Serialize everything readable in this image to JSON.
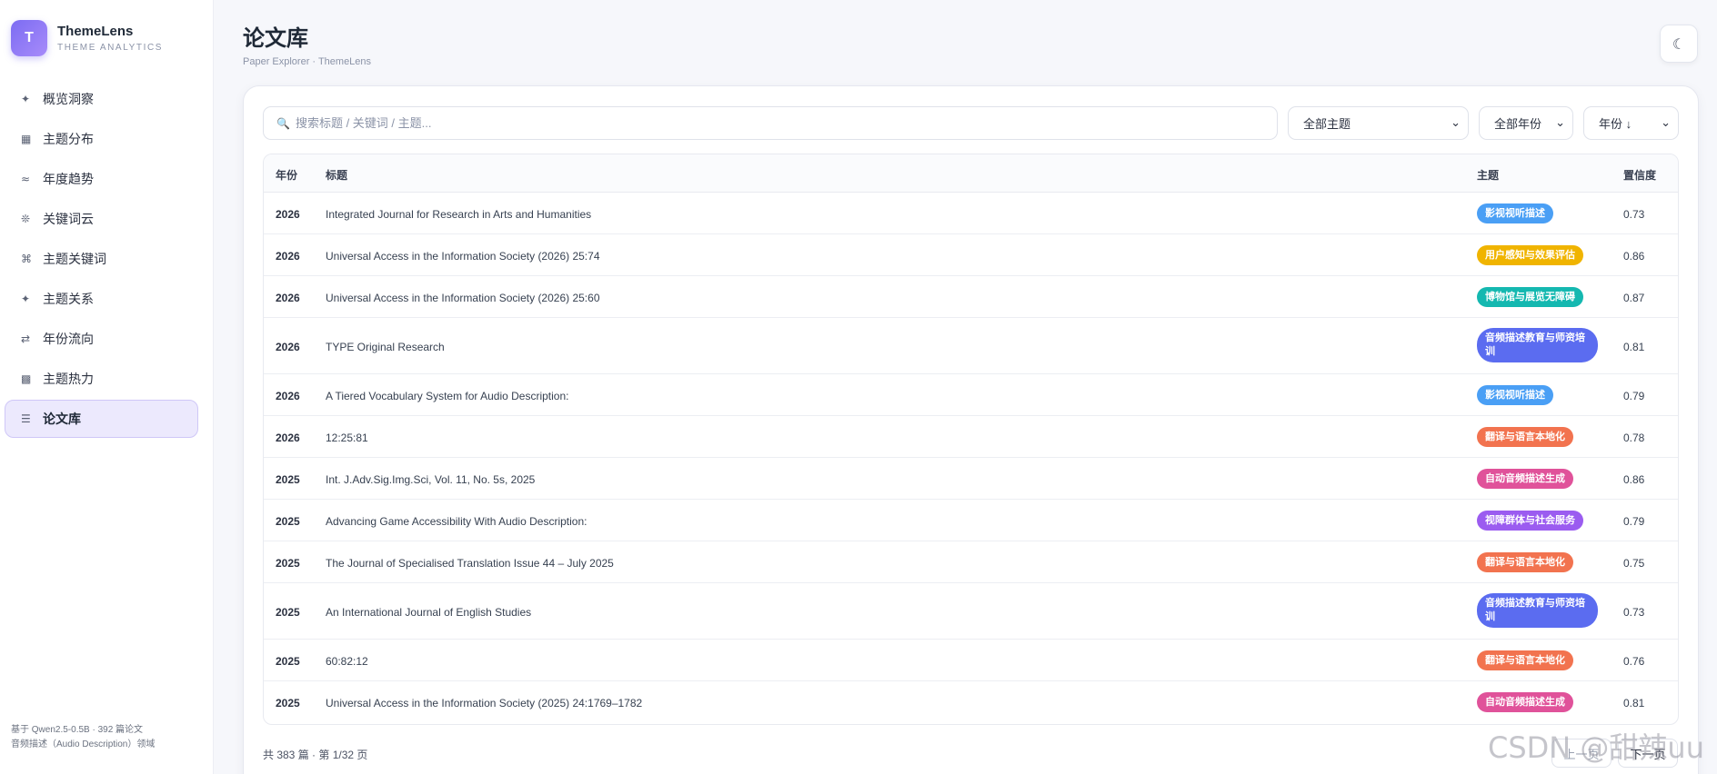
{
  "brand": {
    "logo_letter": "T",
    "name": "ThemeLens",
    "subtitle": "THEME ANALYTICS"
  },
  "sidebar": {
    "items": [
      {
        "icon": "✦",
        "icon_name": "sparkle-icon",
        "label": "概览洞察"
      },
      {
        "icon": "▦",
        "icon_name": "bar-grid-icon",
        "label": "主题分布"
      },
      {
        "icon": "≈",
        "icon_name": "wave-icon",
        "label": "年度趋势"
      },
      {
        "icon": "❊",
        "icon_name": "asterisk-icon",
        "label": "关键词云"
      },
      {
        "icon": "⌘",
        "icon_name": "command-icon",
        "label": "主题关键词"
      },
      {
        "icon": "✦",
        "icon_name": "star-icon",
        "label": "主题关系"
      },
      {
        "icon": "⇄",
        "icon_name": "arrows-icon",
        "label": "年份流向"
      },
      {
        "icon": "▩",
        "icon_name": "heatmap-icon",
        "label": "主题热力"
      },
      {
        "icon": "☰",
        "icon_name": "list-icon",
        "label": "论文库",
        "active": true
      }
    ],
    "footer_line1": "基于 Qwen2.5-0.5B · 392 篇论文",
    "footer_line2": "音频描述（Audio Description）领域"
  },
  "header": {
    "title": "论文库",
    "subtitle": "Paper Explorer · ThemeLens",
    "theme_toggle_icon": "☾"
  },
  "filters": {
    "search_icon": "🔍",
    "search_placeholder": "搜索标题 / 关键词 / 主题...",
    "topic_select": "全部主题",
    "year_select": "全部年份",
    "sort_select": "年份 ↓",
    "chevron": "⌄"
  },
  "table": {
    "headers": {
      "year": "年份",
      "title": "标题",
      "topic": "主题",
      "confidence": "置信度"
    },
    "rows": [
      {
        "year": "2026",
        "title": "Integrated Journal for Research in Arts and Humanities",
        "topic": "影视视听描述",
        "topic_color": "#4a9ff5",
        "confidence": "0.73"
      },
      {
        "year": "2026",
        "title": "Universal Access in the Information Society (2026) 25:74",
        "topic": "用户感知与效果评估",
        "topic_color": "#f0b400",
        "confidence": "0.86"
      },
      {
        "year": "2026",
        "title": "Universal Access in the Information Society (2026) 25:60",
        "topic": "博物馆与展览无障碍",
        "topic_color": "#14b8b0",
        "confidence": "0.87"
      },
      {
        "year": "2026",
        "title": "TYPE Original Research",
        "topic": "音频描述教育与师资培训",
        "topic_color": "#5b6cf0",
        "confidence": "0.81",
        "tall": true
      },
      {
        "year": "2026",
        "title": "A Tiered Vocabulary System for Audio Description:",
        "topic": "影视视听描述",
        "topic_color": "#4a9ff5",
        "confidence": "0.79"
      },
      {
        "year": "2026",
        "title": "12:25:81",
        "topic": "翻译与语言本地化",
        "topic_color": "#f2734f",
        "confidence": "0.78"
      },
      {
        "year": "2025",
        "title": "Int. J.Adv.Sig.Img.Sci, Vol. 11, No. 5s, 2025",
        "topic": "自动音频描述生成",
        "topic_color": "#e0529a",
        "confidence": "0.86"
      },
      {
        "year": "2025",
        "title": "Advancing Game Accessibility With Audio Description:",
        "topic": "视障群体与社会服务",
        "topic_color": "#9b5cf0",
        "confidence": "0.79"
      },
      {
        "year": "2025",
        "title": "The Journal of Specialised Translation Issue 44 – July 2025",
        "topic": "翻译与语言本地化",
        "topic_color": "#f2734f",
        "confidence": "0.75"
      },
      {
        "year": "2025",
        "title": "An International Journal of English Studies",
        "topic": "音频描述教育与师资培训",
        "topic_color": "#5b6cf0",
        "confidence": "0.73",
        "tall": true
      },
      {
        "year": "2025",
        "title": "60:82:12",
        "topic": "翻译与语言本地化",
        "topic_color": "#f2734f",
        "confidence": "0.76"
      },
      {
        "year": "2025",
        "title": "Universal Access in the Information Society (2025) 24:1769–1782",
        "topic": "自动音频描述生成",
        "topic_color": "#e0529a",
        "confidence": "0.81"
      }
    ]
  },
  "pagination": {
    "summary": "共 383 篇 · 第 1/32 页",
    "prev": "上一页",
    "next": "下一页"
  },
  "watermark": "CSDN @甜辣uu"
}
